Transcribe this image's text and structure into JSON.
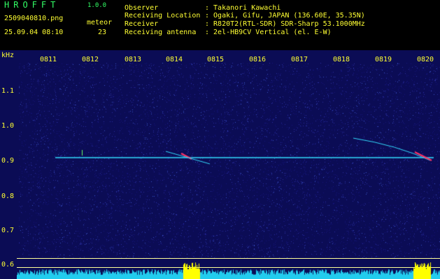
{
  "header": {
    "app_title": "HROFFT",
    "version": "1.0.0",
    "filename": "2509040810.png",
    "datetime": "25.09.04 08:10",
    "meteor_label": "meteor",
    "meteor_count": "23",
    "info": [
      {
        "key": "Observer",
        "value": ": Takanori Kawachi"
      },
      {
        "key": "Receiving Location",
        "value": ": Ogaki, Gifu, JAPAN (136.60E, 35.35N)"
      },
      {
        "key": "Receiver",
        "value": ": R820T2(RTL-SDR) SDR-Sharp 53.1000MHz"
      },
      {
        "key": "Receiving antenna",
        "value": ": 2el-HB9CV Vertical (el. E-W)"
      }
    ]
  },
  "axes": {
    "y_unit": "kHz",
    "y_ticks": [
      "1.1",
      "1.0",
      "0.9",
      "0.8",
      "0.7",
      "0.6"
    ],
    "x_ticks": [
      "0811",
      "0812",
      "0813",
      "0814",
      "0815",
      "0816",
      "0817",
      "0818",
      "0819",
      "0820"
    ]
  },
  "colors": {
    "background": "#0b0c55",
    "carrier": "#33ddff",
    "meteor": "#ff3366",
    "tick_text": "#ffff33",
    "level_cyan": "#22ccee",
    "level_yellow": "#ffff00"
  }
}
